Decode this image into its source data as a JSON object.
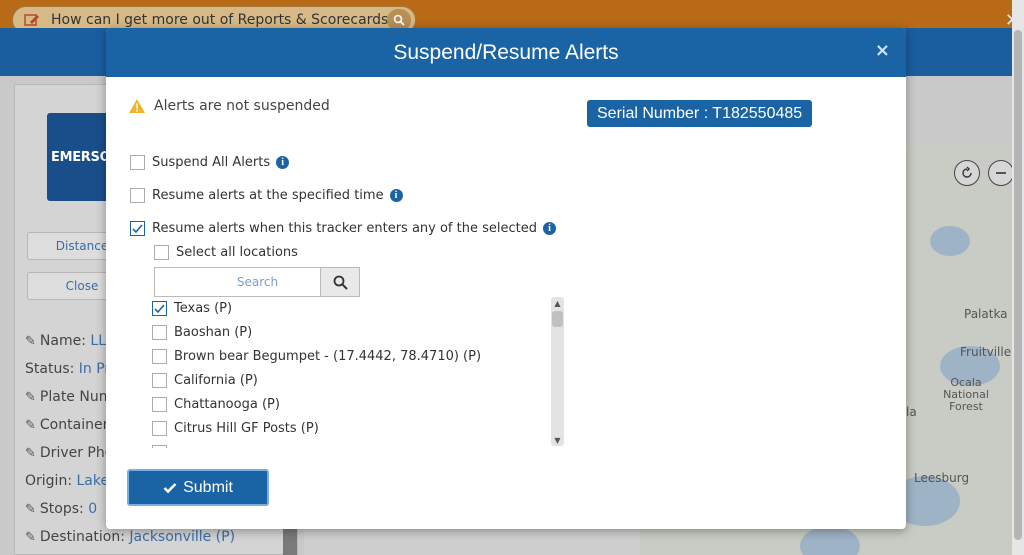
{
  "background": {
    "help_search_text": "How can I get more out of Reports & Scorecards?",
    "logo_text": "EMERSO",
    "left_buttons": [
      "Distance",
      "Close"
    ],
    "info_rows": [
      {
        "label": "Name:",
        "value": "LL-",
        "pencil": true
      },
      {
        "label": "Status:",
        "value": "In Pro",
        "pencil": false
      },
      {
        "label": "Plate Numb",
        "value": "",
        "pencil": true
      },
      {
        "label": "Container",
        "value": "",
        "pencil": true
      },
      {
        "label": "Driver Pho",
        "value": "",
        "pencil": true
      },
      {
        "label": "Origin:",
        "value": "LakeL",
        "pencil": false
      },
      {
        "label": "Stops:",
        "value": "0",
        "pencil": true
      },
      {
        "label": "Destination:",
        "value": "Jacksonville (P)",
        "pencil": true
      }
    ],
    "map_labels": [
      {
        "text": "Palatka",
        "id": "palatka"
      },
      {
        "text": "Fruitville",
        "id": "fruitville"
      },
      {
        "text": "Ocala National Forest",
        "id": "ocala"
      },
      {
        "text": "la",
        "id": "la"
      },
      {
        "text": "Leesburg",
        "id": "leesburg"
      }
    ]
  },
  "modal": {
    "title": "Suspend/Resume Alerts",
    "close_icon": "×",
    "status_text": "Alerts are not suspended",
    "serial_label": "Serial Number : T182550485",
    "options": [
      {
        "label": "Suspend All Alerts",
        "checked": false
      },
      {
        "label": "Resume alerts at the specified time",
        "checked": false
      },
      {
        "label": "Resume alerts when this tracker enters any of the selected",
        "checked": true
      }
    ],
    "select_all_label": "Select all locations",
    "search_placeholder": "Search",
    "locations": [
      {
        "label": "Texas (P)",
        "checked": true
      },
      {
        "label": "Baoshan (P)",
        "checked": false
      },
      {
        "label": "Brown bear Begumpet - (17.4442, 78.4710) (P)",
        "checked": false
      },
      {
        "label": "California (P)",
        "checked": false
      },
      {
        "label": "Chattanooga (P)",
        "checked": false
      },
      {
        "label": "Citrus Hill GF Posts (P)",
        "checked": false
      }
    ],
    "submit_label": "Submit"
  }
}
